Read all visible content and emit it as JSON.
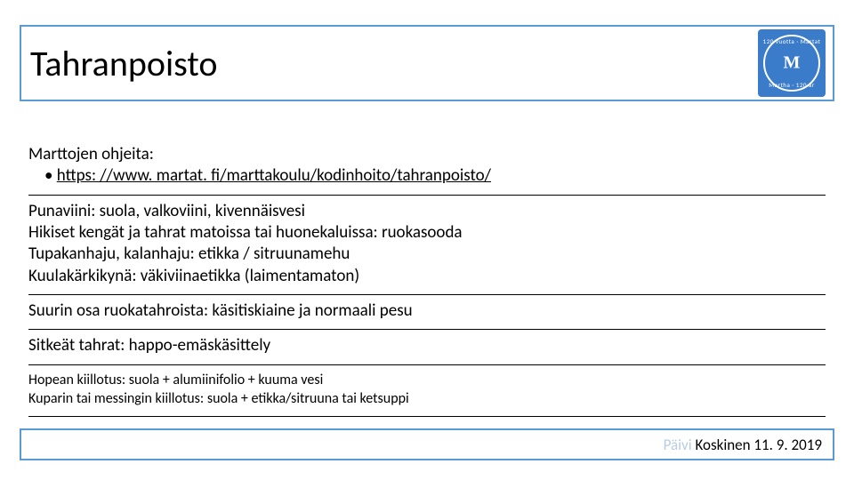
{
  "title": "Tahranpoisto",
  "logo": {
    "top_text": "120 vuotta · Martat",
    "bottom_text": "Martha · 120 år",
    "center": "M"
  },
  "intro": "Marttojen ohjeita:",
  "link_bullet": " https: //www. martat. fi/marttakoulu/kodinhoito/tahranpoisto/",
  "block1": {
    "l1": "Punaviini: suola, valkoviini, kivennäisvesi",
    "l2": "Hikiset kengät ja tahrat matoissa tai huonekaluissa: ruokasooda",
    "l3": "Tupakanhaju, kalanhaju: etikka / sitruunamehu",
    "l4": "Kuulakärkikynä: väkiviinaetikka (laimentamaton)"
  },
  "block2": "Suurin osa ruokatahroista: käsitiskiaine ja normaali pesu",
  "block3": "Sitkeät tahrat: happo-emäskäsittely",
  "block4": {
    "l1": "Hopean kiillotus: suola + alumiinifolio + kuuma vesi",
    "l2": "Kuparin tai messingin kiillotus: suola + etikka/sitruuna tai ketsuppi"
  },
  "footer": {
    "faded": "Päivi",
    "rest": " Koskinen 11. 9. 2019"
  }
}
